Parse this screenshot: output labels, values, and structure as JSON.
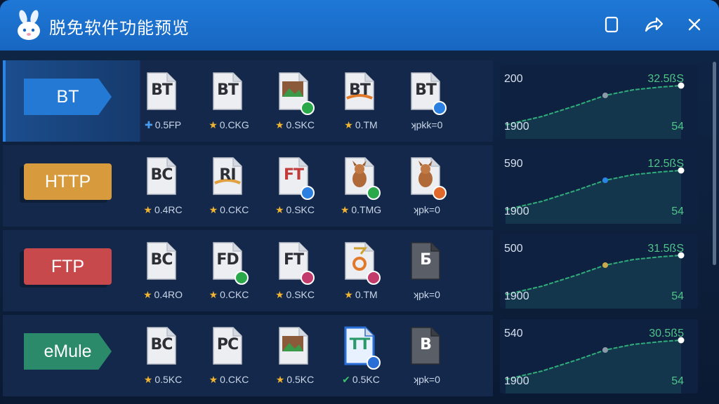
{
  "window": {
    "title": "脱免软件功能预览"
  },
  "rows": [
    {
      "protocol": "BT",
      "color": "#2379d3",
      "files": [
        {
          "label": "BT",
          "meta": "0.5FP",
          "mark": "✚",
          "markColor": "#4a9bf0",
          "badge": ""
        },
        {
          "label": "BT",
          "meta": "0.CKG",
          "mark": "★",
          "markColor": "#f2b430",
          "badge": ""
        },
        {
          "label": "",
          "meta": "0.SKC",
          "mark": "★",
          "markColor": "#f2b430",
          "badge": "#2aa84a",
          "img": "photo"
        },
        {
          "label": "BT",
          "meta": "0.TM",
          "mark": "★",
          "markColor": "#f2b430",
          "badge": "",
          "swoosh": "#e07a2a"
        },
        {
          "label": "BT",
          "meta": "ʞpkk=0",
          "mark": "",
          "markColor": "#c9d6e8",
          "badge": "#2a7fe0"
        }
      ],
      "spark": {
        "ymax": "200",
        "value": "32.5ßS",
        "x_start": "1900",
        "x_end": "54",
        "dot": "#8a9aa8"
      }
    },
    {
      "protocol": "HTTP",
      "color": "#d79a3c",
      "files": [
        {
          "label": "BC",
          "meta": "0.4RC",
          "mark": "★",
          "markColor": "#f2b430",
          "badge": ""
        },
        {
          "label": "RI",
          "meta": "0.CKC",
          "mark": "★",
          "markColor": "#f2b430",
          "badge": "",
          "swoosh": "#e0a040"
        },
        {
          "label": "FT",
          "meta": "0.SKC",
          "mark": "★",
          "markColor": "#f2b430",
          "badge": "#2a7fe0",
          "labelColor": "#c23b3b"
        },
        {
          "label": "",
          "meta": "0.TMG",
          "mark": "★",
          "markColor": "#f2b430",
          "badge": "#2aa84a",
          "img": "animal"
        },
        {
          "label": "",
          "meta": "ʞpk=0",
          "mark": "",
          "markColor": "#c9d6e8",
          "badge": "#e0682a",
          "img": "animal"
        }
      ],
      "spark": {
        "ymax": "590",
        "value": "12.5ßS",
        "x_start": "1900",
        "x_end": "54",
        "dot": "#2a86e6"
      }
    },
    {
      "protocol": "FTP",
      "color": "#c8494b",
      "files": [
        {
          "label": "BC",
          "meta": "0.4RO",
          "mark": "★",
          "markColor": "#f2b430",
          "badge": ""
        },
        {
          "label": "FD",
          "meta": "0.CKC",
          "mark": "★",
          "markColor": "#f2b430",
          "badge": "#2aa84a"
        },
        {
          "label": "FT",
          "meta": "0.SKC",
          "mark": "★",
          "markColor": "#f2b430",
          "badge": "#c23b6a"
        },
        {
          "label": "",
          "meta": "0.TM",
          "mark": "★",
          "markColor": "#f2b430",
          "badge": "#c23b6a",
          "img": "ring"
        },
        {
          "label": "Б",
          "meta": "ʞpk=0",
          "mark": "",
          "markColor": "#c9d6e8",
          "badge": "",
          "dark": true
        }
      ],
      "spark": {
        "ymax": "500",
        "value": "31.5ßS",
        "x_start": "1900",
        "x_end": "54",
        "dot": "#c8a94b"
      }
    },
    {
      "protocol": "eMule",
      "color": "#2a8a6a",
      "files": [
        {
          "label": "BC",
          "meta": "0.5KC",
          "mark": "★",
          "markColor": "#f2b430",
          "badge": ""
        },
        {
          "label": "PC",
          "meta": "0.CKC",
          "mark": "★",
          "markColor": "#f2b430",
          "badge": ""
        },
        {
          "label": "",
          "meta": "0.5KC",
          "mark": "★",
          "markColor": "#f2b430",
          "badge": "",
          "img": "photo"
        },
        {
          "label": "TT",
          "meta": "0.5KC",
          "mark": "✔",
          "markColor": "#3cc46a",
          "badge": "#2a6fd6",
          "blue": true
        },
        {
          "label": "B",
          "meta": "ʞpk=0",
          "mark": "",
          "markColor": "#c9d6e8",
          "badge": "",
          "dark": true
        }
      ],
      "spark": {
        "ymax": "540",
        "value": "30.5ß5",
        "x_start": "1900",
        "x_end": "54",
        "dot": "#8a9aa8"
      }
    }
  ],
  "icons": {
    "logo": "rabbit-icon",
    "square": "square-icon",
    "share": "share-icon",
    "close": "close-icon",
    "star": "star-icon"
  }
}
